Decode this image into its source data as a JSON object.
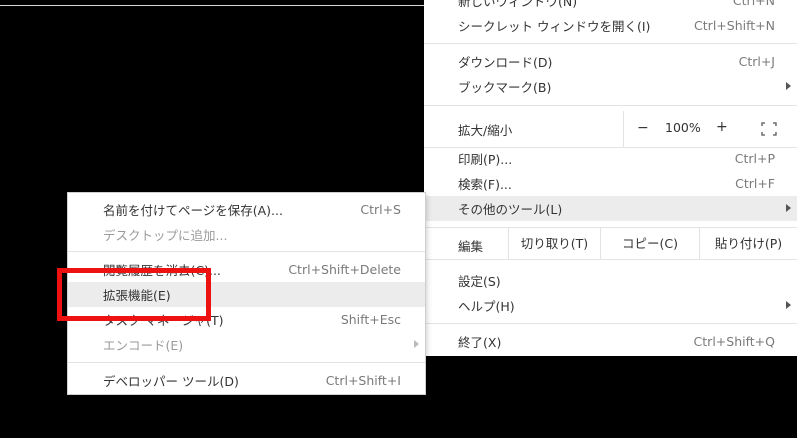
{
  "main_menu": {
    "new_window": {
      "label": "新しいウィンドウ(N)",
      "shortcut": "Ctrl+N"
    },
    "incognito": {
      "label": "シークレット ウィンドウを開く(I)",
      "shortcut": "Ctrl+Shift+N"
    },
    "downloads": {
      "label": "ダウンロード(D)",
      "shortcut": "Ctrl+J"
    },
    "bookmarks": {
      "label": "ブックマーク(B)"
    },
    "zoom": {
      "label": "拡大/縮小",
      "minus": "−",
      "value": "100%",
      "plus": "+"
    },
    "print": {
      "label": "印刷(P)...",
      "shortcut": "Ctrl+P"
    },
    "find": {
      "label": "検索(F)...",
      "shortcut": "Ctrl+F"
    },
    "more_tools": {
      "label": "その他のツール(L)"
    },
    "edit": {
      "label": "編集",
      "cut": "切り取り(T)",
      "copy": "コピー(C)",
      "paste": "貼り付け(P)"
    },
    "settings": {
      "label": "設定(S)"
    },
    "help": {
      "label": "ヘルプ(H)"
    },
    "exit": {
      "label": "終了(X)",
      "shortcut": "Ctrl+Shift+Q"
    }
  },
  "sub_menu": {
    "save_page": {
      "label": "名前を付けてページを保存(A)...",
      "shortcut": "Ctrl+S"
    },
    "add_to_desktop": {
      "label": "デスクトップに追加..."
    },
    "clear_history": {
      "label": "閲覧履歴を消去(C)...",
      "shortcut": "Ctrl+Shift+Delete"
    },
    "extensions": {
      "label": "拡張機能(E)"
    },
    "task_manager": {
      "label": "タスク マネージャ(T)",
      "shortcut": "Shift+Esc"
    },
    "encoding": {
      "label": "エンコード(E)"
    },
    "dev_tools": {
      "label": "デベロッパー ツール(D)",
      "shortcut": "Ctrl+Shift+I"
    }
  },
  "colors": {
    "highlight": "#ececec",
    "annotation": "#ee1111",
    "background": "#000000"
  },
  "icons": {
    "submenu_arrow": "arrow-right-icon",
    "fullscreen": "fullscreen-icon"
  }
}
